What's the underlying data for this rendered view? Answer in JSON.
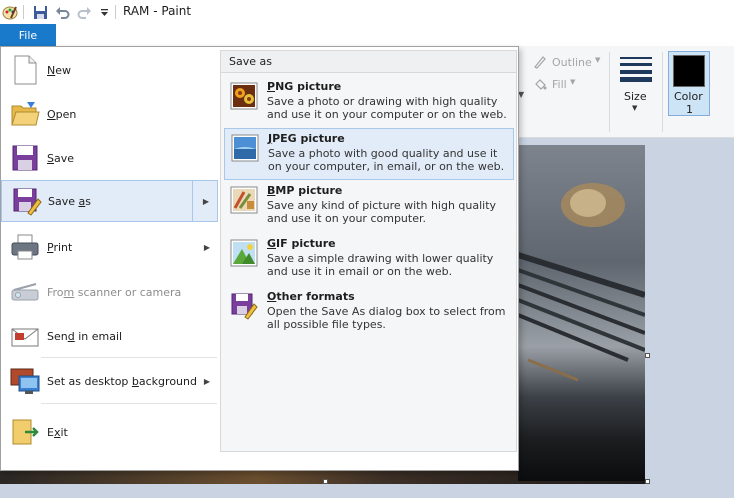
{
  "window": {
    "title": "RAM - Paint"
  },
  "ribbon": {
    "file_tab": "File",
    "outline": "Outline",
    "fill": "Fill",
    "size": "Size",
    "color1": "Color",
    "color1_num": "1",
    "color1_value": "#000000"
  },
  "menu": {
    "items": [
      {
        "pre": "",
        "acc": "N",
        "post": "ew"
      },
      {
        "pre": "",
        "acc": "O",
        "post": "pen"
      },
      {
        "pre": "",
        "acc": "S",
        "post": "ave"
      },
      {
        "pre": "Save ",
        "acc": "a",
        "post": "s"
      },
      {
        "pre": "",
        "acc": "P",
        "post": "rint"
      },
      {
        "pre": "Fro",
        "acc": "m",
        "post": " scanner or camera"
      },
      {
        "pre": "Sen",
        "acc": "d",
        "post": " in email"
      },
      {
        "pre": "Set as desktop ",
        "acc": "b",
        "post": "ackground"
      },
      {
        "pre": "E",
        "acc": "x",
        "post": "it"
      }
    ]
  },
  "saveas": {
    "header": "Save as",
    "options": [
      {
        "acc": "P",
        "rest": "NG picture",
        "desc": "Save a photo or drawing with high quality and use it on your computer or on the web."
      },
      {
        "acc": "J",
        "rest": "PEG picture",
        "desc": "Save a photo with good quality and use it on your computer, in email, or on the web."
      },
      {
        "acc": "B",
        "rest": "MP picture",
        "desc": "Save any kind of picture with high quality and use it on your computer."
      },
      {
        "acc": "G",
        "rest": "IF picture",
        "desc": "Save a simple drawing with lower quality and use it in email or on the web."
      },
      {
        "acc": "O",
        "rest": "ther formats",
        "desc": "Open the Save As dialog box to select from all possible file types."
      }
    ]
  }
}
